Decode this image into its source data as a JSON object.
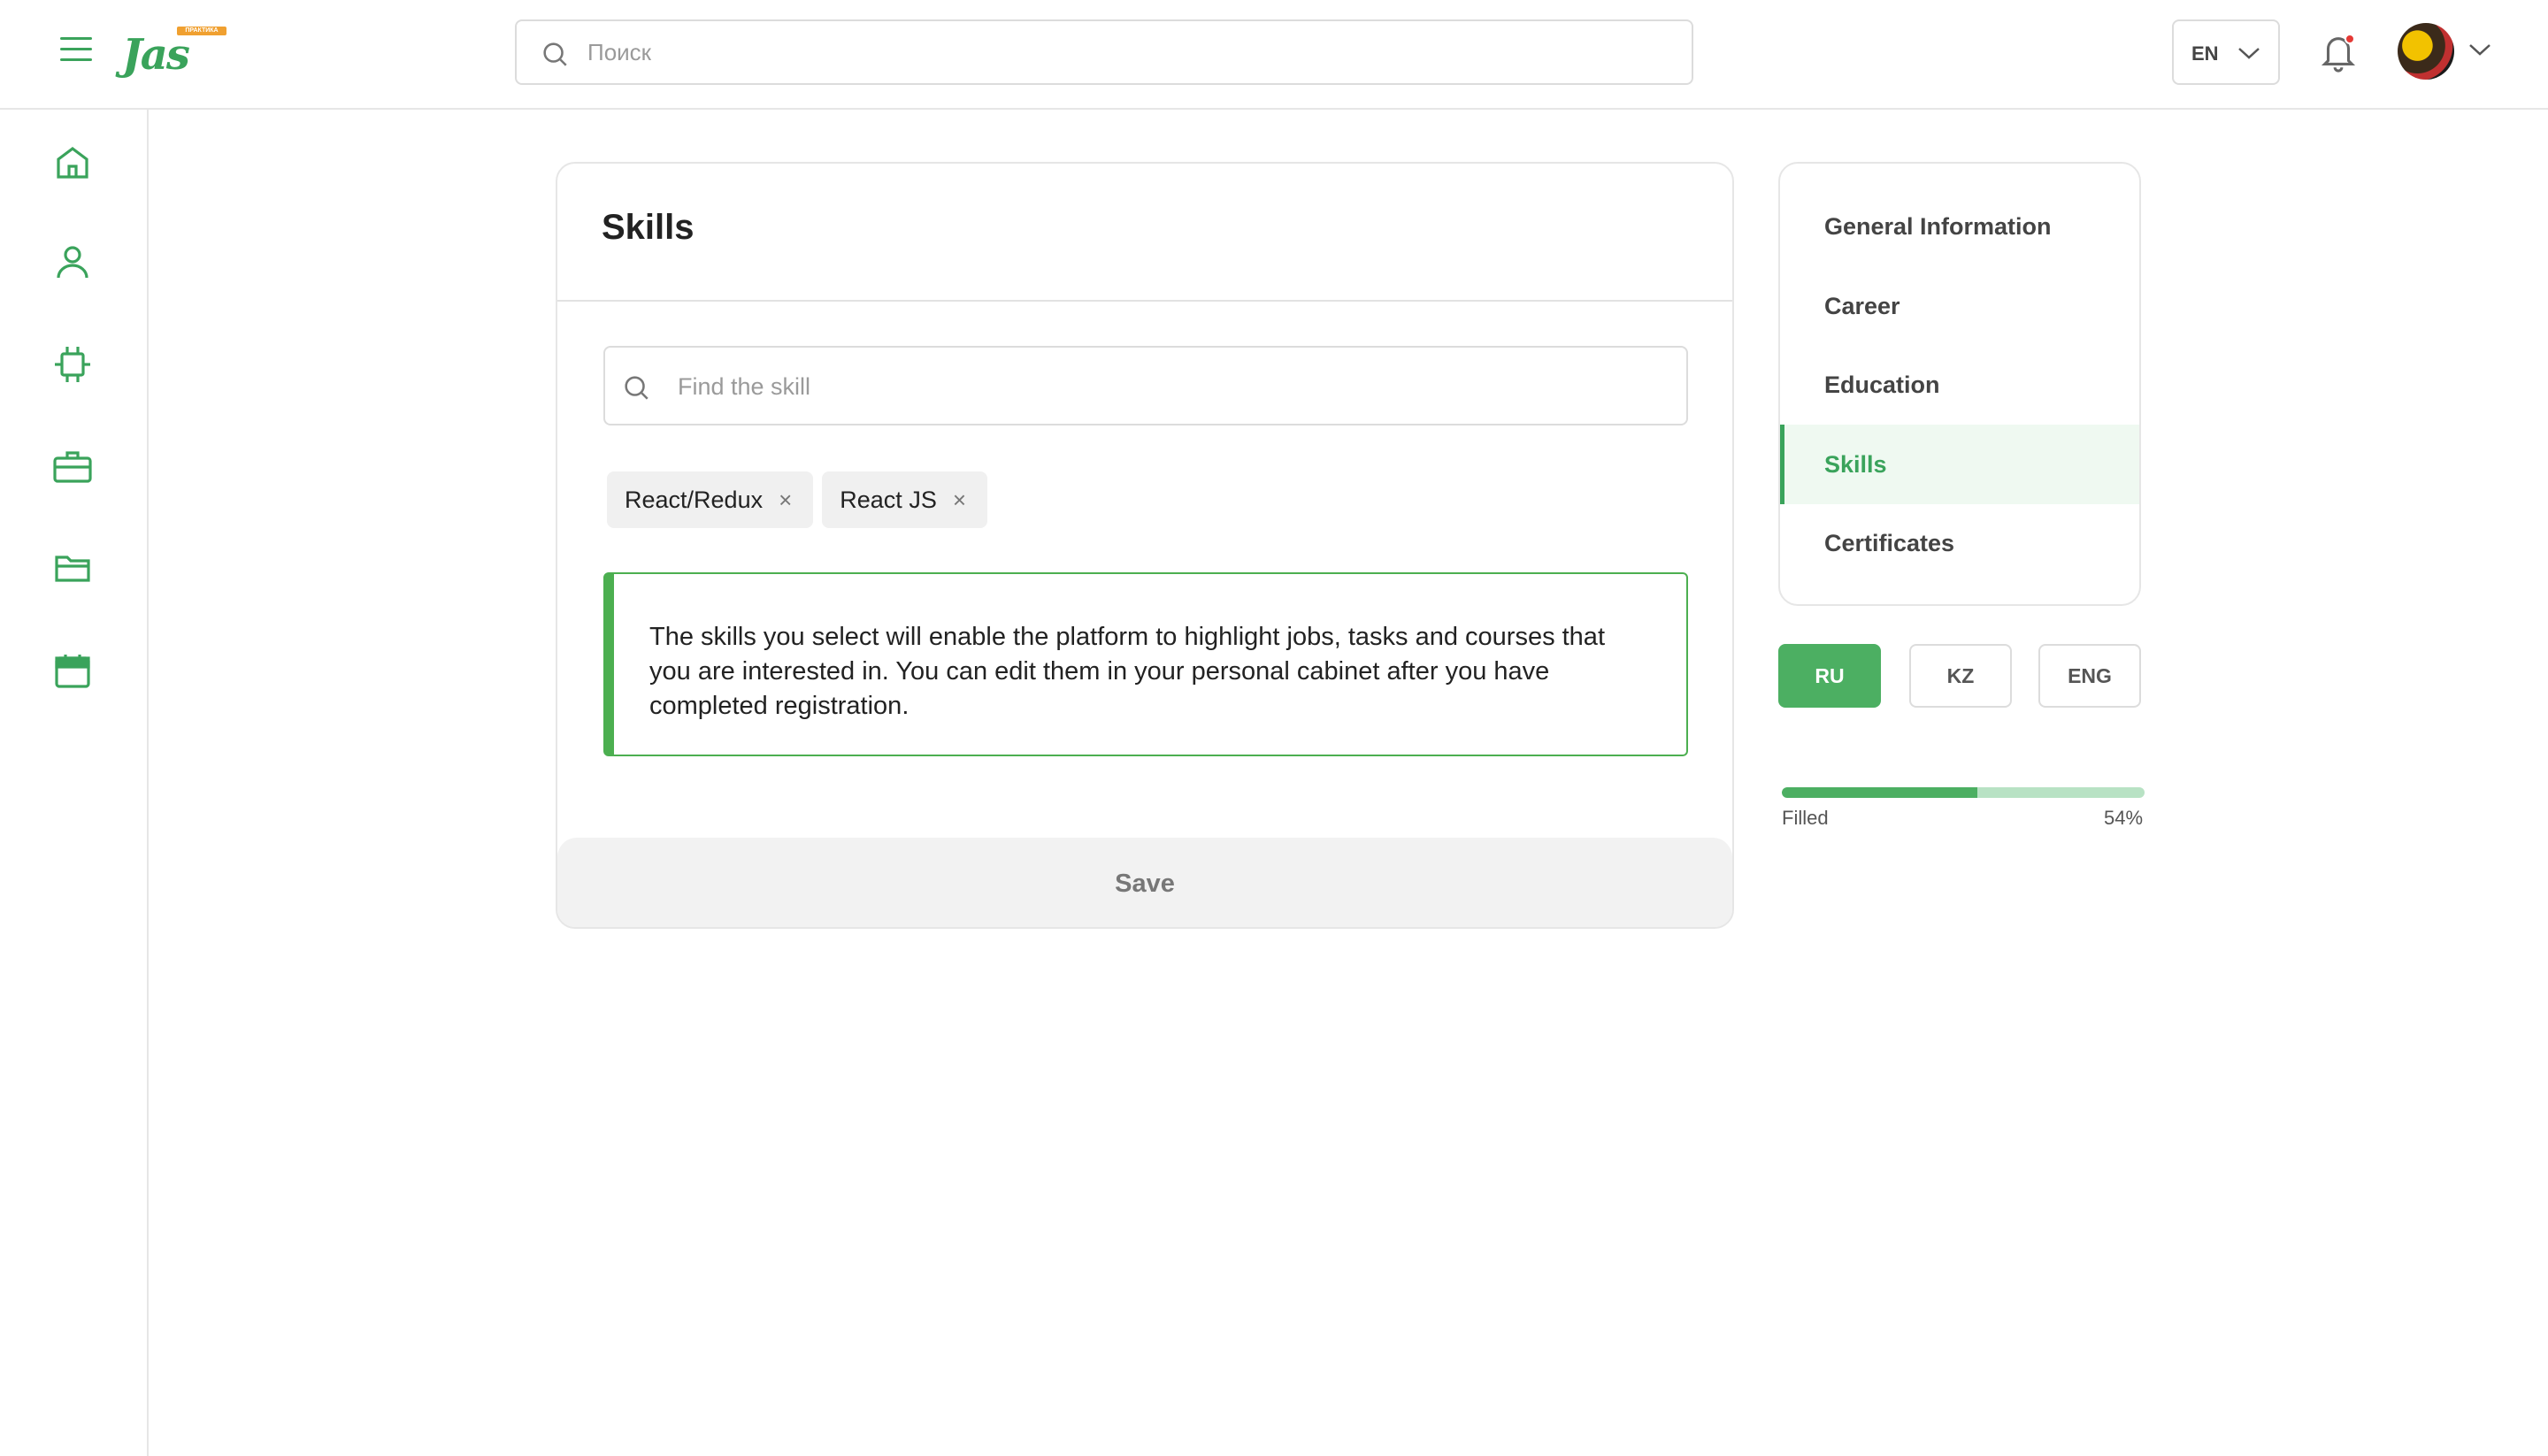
{
  "header": {
    "logo_text": "Jas",
    "logo_tag": "ПРАКТИКА",
    "search_placeholder": "Поиск",
    "language": "EN"
  },
  "rail": {
    "items": [
      "home-icon",
      "user-icon",
      "chip-icon",
      "briefcase-icon",
      "folder-icon",
      "calendar-icon"
    ]
  },
  "card": {
    "title": "Skills",
    "search_placeholder": "Find the skill",
    "tags": [
      {
        "label": "React/Redux",
        "remove": "×"
      },
      {
        "label": "React JS",
        "remove": "×"
      }
    ],
    "info_text": "The skills you select will enable the platform to highlight jobs, tasks and courses that you are interested in. You can edit them in your personal cabinet after you have completed registration.",
    "save_label": "Save"
  },
  "side_nav": {
    "items": [
      {
        "label": "General Information",
        "active": false
      },
      {
        "label": "Career",
        "active": false
      },
      {
        "label": "Education",
        "active": false
      },
      {
        "label": "Skills",
        "active": true
      },
      {
        "label": "Certificates",
        "active": false
      }
    ]
  },
  "languages": {
    "options": [
      "RU",
      "KZ",
      "ENG"
    ],
    "selected": "RU"
  },
  "progress": {
    "label": "Filled",
    "value_text": "54%",
    "value": 54
  },
  "colors": {
    "accent": "#4caf62",
    "accent_dark": "#3aa35b",
    "notification": "#e53935"
  }
}
